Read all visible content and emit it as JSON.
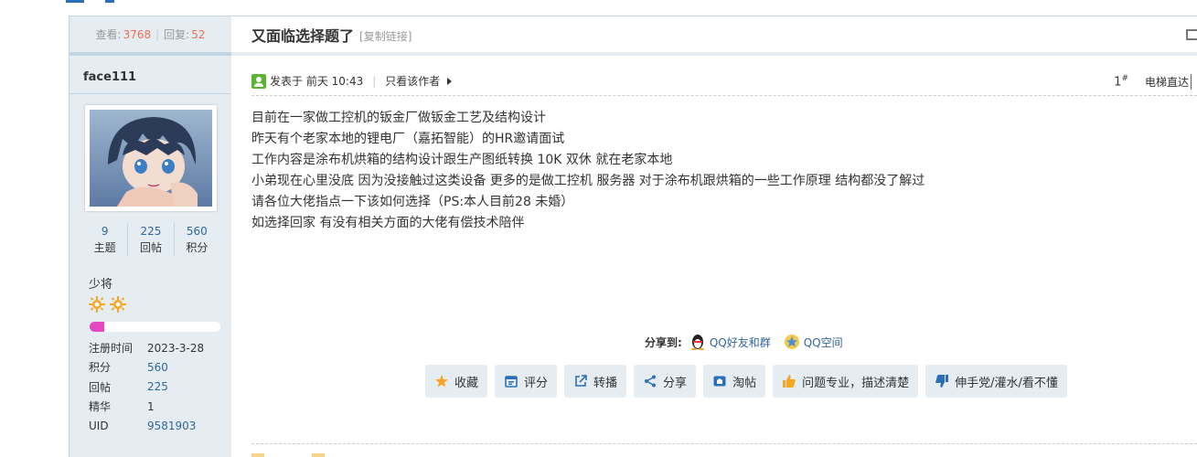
{
  "thread": {
    "views_label": "查看:",
    "views": "3768",
    "replies_label": "回复:",
    "replies": "52",
    "title": "又面临选择题了",
    "copy_link": "[复制链接]"
  },
  "author": {
    "name": "face111",
    "counts": [
      {
        "value": "9",
        "label": "主题"
      },
      {
        "value": "225",
        "label": "回帖"
      },
      {
        "value": "560",
        "label": "积分"
      }
    ],
    "rank": "少将",
    "progress_fraction": 0.11,
    "info": [
      {
        "key": "注册时间",
        "value": "2023-3-28",
        "dark": true
      },
      {
        "key": "积分",
        "value": "560"
      },
      {
        "key": "回帖",
        "value": "225"
      },
      {
        "key": "精华",
        "value": "1",
        "dark": true
      },
      {
        "key": "UID",
        "value": "9581903"
      }
    ]
  },
  "post": {
    "posted_prefix": "发表于",
    "posted_time": "前天 10:43",
    "only_author": "只看该作者",
    "floor": "1",
    "floor_sup": "#",
    "jump": "电梯直达",
    "lines": [
      "目前在一家做工控机的钣金厂做钣金工艺及结构设计",
      "昨天有个老家本地的锂电厂（嘉拓智能）的HR邀请面试",
      "工作内容是涂布机烘箱的结构设计跟生产图纸转换 10K 双休 就在老家本地",
      "小弟现在心里没底  因为没接触过这类设备  更多的是做工控机 服务器 对于涂布机跟烘箱的一些工作原理  结构都没了解过",
      "请各位大佬指点一下该如何选择（PS:本人目前28  未婚）",
      "如选择回家  有没有相关方面的大佬有偿技术陪伴"
    ]
  },
  "share": {
    "label": "分享到:",
    "qq_friends": "QQ好友和群",
    "qzone": "QQ空间"
  },
  "actions": {
    "favorite": "收藏",
    "rate": "评分",
    "forward": "转播",
    "share": "分享",
    "taobao": "淘帖",
    "like": "问题专业，描述清楚",
    "dislike": "伸手党/灌水/看不懂"
  },
  "colors": {
    "accent": "#336699",
    "highlight": "#f26c4f",
    "side_bg": "#e5edf2",
    "progress": "#e546c2"
  }
}
